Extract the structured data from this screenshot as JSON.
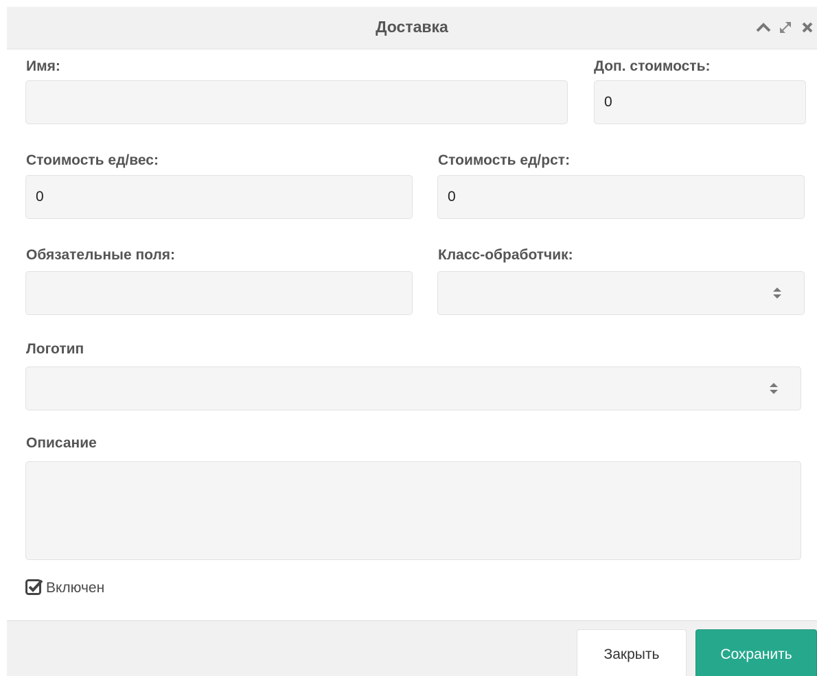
{
  "dialog": {
    "title": "Доставка",
    "icons": [
      "chevron-up-icon",
      "expand-icon",
      "close-icon"
    ]
  },
  "form": {
    "name": {
      "label": "Имя:",
      "value": ""
    },
    "extra_cost": {
      "label": "Доп. стоимость:",
      "value": "0"
    },
    "cost_per_weight": {
      "label": "Стоимость ед/вес:",
      "value": "0"
    },
    "cost_per_rst": {
      "label": "Стоимость ед/рст:",
      "value": "0"
    },
    "required_fields": {
      "label": "Обязательные поля:",
      "value": ""
    },
    "handler_class": {
      "label": "Класс-обработчик:",
      "value": ""
    },
    "logo": {
      "label": "Логотип",
      "value": ""
    },
    "description": {
      "label": "Описание",
      "value": ""
    },
    "enabled": {
      "label": "Включен",
      "checked": true
    }
  },
  "footer": {
    "close_label": "Закрыть",
    "save_label": "Сохранить"
  },
  "colors": {
    "accent": "#26a88d",
    "titlebar": "#f1f1f1",
    "field_bg": "#f5f5f5"
  }
}
